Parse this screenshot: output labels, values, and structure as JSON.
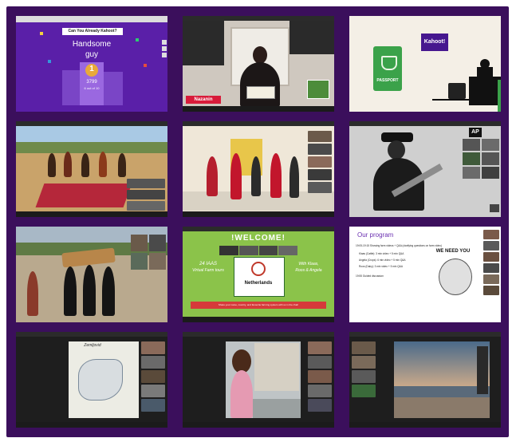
{
  "tile1": {
    "question": "Can You Already Kahoot?",
    "headline1": "Handsome",
    "headline2": "guy",
    "rank": "1",
    "score": "3799",
    "streak": "6 out of 10",
    "colors": {
      "bg": "#5a1fa8",
      "podium": "#8e5bd4",
      "gold": "#e8a93a"
    }
  },
  "tile2": {
    "name_tag": "Nazanin",
    "colors": {
      "tag": "#d81b3a"
    }
  },
  "tile3": {
    "passport": "PASSPORT",
    "brand": "Kahoot!",
    "colors": {
      "passport": "#3ba24a",
      "brand_bg": "#46178f"
    }
  },
  "tile6": {
    "badge": "AP"
  },
  "tile8": {
    "banner": "!WELCOME!",
    "event_left1": "24 IAAS",
    "event_left2": "Virtual Farm tours",
    "logo_text": "Netherlands",
    "event_right1": "With Klaas,",
    "event_right2": "Roos & Angela",
    "footer": "Share your name, country, and favourite farming system with us in the chat!",
    "colors": {
      "bg": "#8bc34a"
    }
  },
  "tile9": {
    "heading": "Our program",
    "line1": "19:05-19:15 Showing farm videos + Q&A (clarifying questions on farm video)",
    "line2": "Klaas (Cattle): 3 min video + 5 min Q&A",
    "line3": "Angela (Crops): 6 min video + 5 min Q&A",
    "line4": "Roos (Dairy): 3 min video + 5 min Q&A",
    "line5": "19:55 Guided discussion",
    "poster": "WE NEED YOU"
  },
  "tile10": {
    "map_title": "Zemljovid"
  }
}
